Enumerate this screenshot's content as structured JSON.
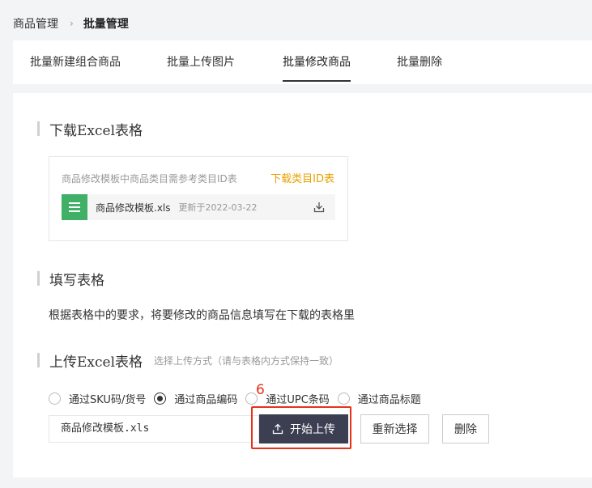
{
  "breadcrumb": {
    "parent": "商品管理",
    "separator": "›",
    "current": "批量管理"
  },
  "tabs": [
    {
      "label": "批量新建组合商品"
    },
    {
      "label": "批量上传图片"
    },
    {
      "label": "批量修改商品",
      "active": true
    },
    {
      "label": "批量删除"
    }
  ],
  "download_section": {
    "title": "下载Excel表格",
    "note": "商品修改模板中商品类目需参考类目ID表",
    "link": "下载类目ID表",
    "file_name": "商品修改模板.xls",
    "file_date": "更新于2022-03-22"
  },
  "fill_section": {
    "title": "填写表格",
    "description": "根据表格中的要求，将要修改的商品信息填写在下载的表格里"
  },
  "upload_section": {
    "title": "上传Excel表格",
    "hint": "选择上传方式（请与表格内方式保持一致）",
    "options": [
      {
        "label": "通过SKU码/货号",
        "checked": false
      },
      {
        "label": "通过商品编码",
        "checked": true
      },
      {
        "label": "通过UPC条码",
        "checked": false
      },
      {
        "label": "通过商品标题",
        "checked": false
      }
    ],
    "file_value": "商品修改模板.xls",
    "upload_button": "开始上传",
    "reselect_button": "重新选择",
    "delete_button": "删除",
    "step_number": "6"
  },
  "colors": {
    "accent_link": "#e8a100",
    "primary_button": "#3c3f52",
    "highlight": "#e8311a",
    "excel_green": "#3fb065"
  }
}
